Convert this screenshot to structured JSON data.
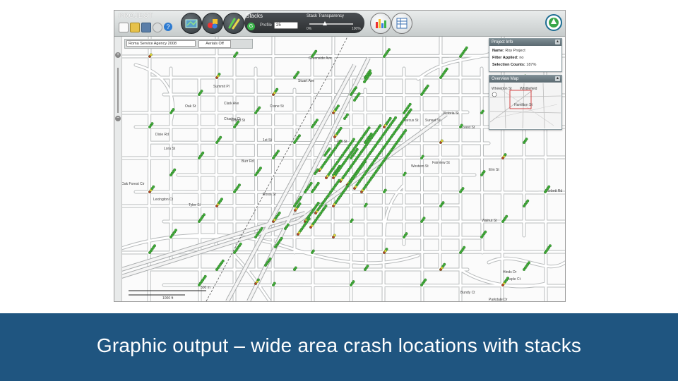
{
  "app": {
    "title": "PROJECT",
    "stacks": {
      "title": "Stacks",
      "go": "G",
      "profile_label": "Profile",
      "profile_value": "25",
      "transparency_label": "Stack Transparency",
      "transparency_min": "0%",
      "transparency_max": "100%",
      "transparency_value": 0.35
    },
    "agency_select": "Roma Service Agency 2008",
    "aerials_label": "Aerials Off",
    "project_info": {
      "title": "Project Info",
      "rows": [
        {
          "label": "Name:",
          "value": "Roy Project"
        },
        {
          "label": "Filter Applied:",
          "value": "no"
        },
        {
          "label": "Selection Counts:",
          "value": "187%"
        }
      ]
    },
    "overview_map": {
      "title": "Overview Map",
      "labels": [
        "Wheeldon St",
        "Whittlefield",
        "Hamilton St"
      ]
    },
    "scale": {
      "label_top": "500 m",
      "label_bottom": "1000 ft"
    },
    "street_labels": [
      "Stuart Ave",
      "Greenside Ave",
      "Summit Pl",
      "Oak St",
      "Clark Ave",
      "Charles Ct",
      "Dixie Rd",
      "Lora St",
      "Crane St",
      "Grand St",
      "1st St",
      "2nd St",
      "Burr Rd",
      "Western St",
      "Fairview St",
      "Sunset St",
      "Victoria St",
      "Marcus St",
      "Forest St",
      "Elm St",
      "Tyler St",
      "Rossi St",
      "Oak Forest Cir",
      "Lexington Ct",
      "Hinds Dr",
      "Maple Ct",
      "Bundy Ct",
      "Parkdale Dr",
      "Walnut St",
      "Corbett Rd"
    ]
  },
  "caption": "Graphic output – wide area crash locations with stacks",
  "colors": {
    "band": "#1f5580",
    "stack_green": "#3fae3a",
    "stack_yellow": "#e8d53a",
    "stack_red": "#c23a2a"
  }
}
